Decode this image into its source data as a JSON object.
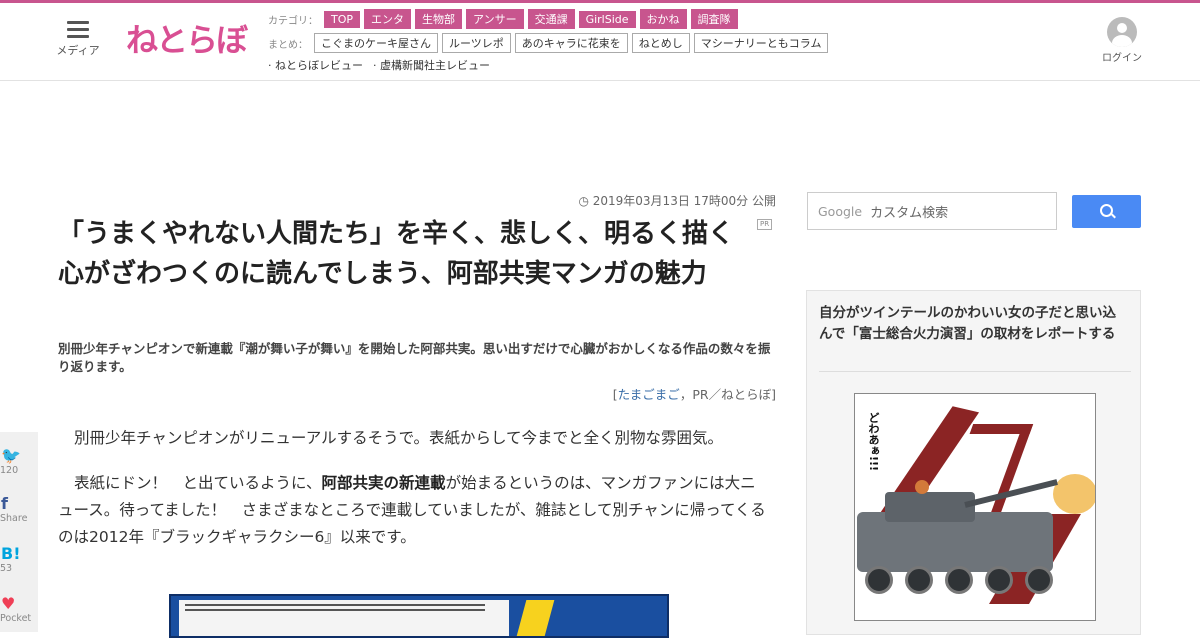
{
  "header": {
    "menu_label": "メディア",
    "logo_text": "ねとらぼ",
    "category_label": "カテゴリ：",
    "categories": [
      "TOP",
      "エンタ",
      "生物部",
      "アンサー",
      "交通課",
      "GirlSide",
      "おかね",
      "調査隊"
    ],
    "matome_label": "まとめ：",
    "matome": [
      "こぐまのケーキ屋さん",
      "ルーツレポ",
      "あのキャラに花束を",
      "ねとめし",
      "マシーナリーともコラム"
    ],
    "reviews": [
      "· ねとらぼレビュー",
      "· 虚構新聞社主レビュー"
    ],
    "login_label": "ログイン"
  },
  "colors": {
    "accent": "#c8558e",
    "link": "#3a6ea8",
    "search_button": "#4a8af4"
  },
  "article": {
    "date": "2019年03月13日 17時00分 公開",
    "pr_badge": "PR",
    "title": "「うまくやれない人間たち」を辛く、悲しく、明るく描く　心がざわつくのに読んでしまう、阿部共実マンガの魅力",
    "lead": "別冊少年チャンピオンで新連載『潮が舞い子が舞い』を開始した阿部共実。思い出すだけで心臓がおかしくなる作品の数々を振り返ります。",
    "author_open": "[",
    "author_link": "たまごまご",
    "author_rest": "，PR／ねとらぼ]",
    "para1": "別冊少年チャンピオンがリニューアルするそうで。表紙からして今までと全く別物な雰囲気。",
    "para2_a": "表紙にドン！　と出ているように、",
    "para2_b": "阿部共実の新連載",
    "para2_c": "が始まるというのは、マンガファンには大ニュース。待ってました！　さまざまなところで連載していましたが、雑誌として別チャンに帰ってくるのは2012年『ブラックギャラクシー6』以来です。"
  },
  "share": [
    {
      "icon": "twitter-icon",
      "glyph": "🐦",
      "count": "120"
    },
    {
      "icon": "facebook-icon",
      "glyph": "f",
      "count": "Share"
    },
    {
      "icon": "hatena-icon",
      "glyph": "B!",
      "count": "53"
    },
    {
      "icon": "pocket-icon",
      "glyph": "♥",
      "count": "Pocket"
    }
  ],
  "search": {
    "brand": "Google",
    "placeholder": "カスタム検索"
  },
  "sidebar": {
    "feature_title": "自分がツインテールのかわいい女の子だと思い込んで「富士総合火力演習」の取材をレポートする",
    "manga_bubble": "どわあぁ!!!"
  }
}
